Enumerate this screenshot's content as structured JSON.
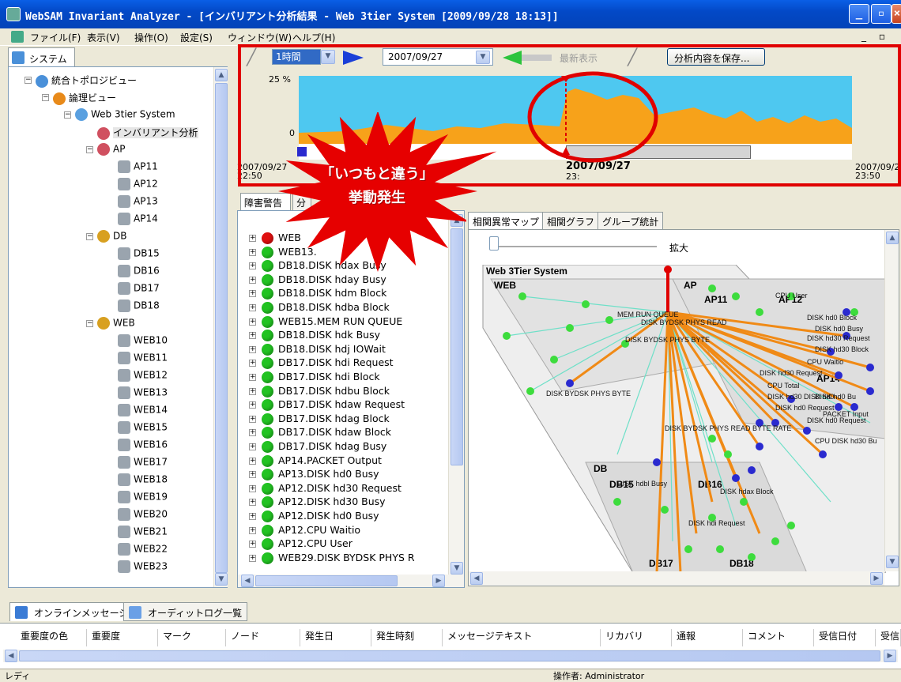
{
  "window": {
    "title": "WebSAM Invariant Analyzer - [インバリアント分析結果 - Web 3tier System [2009/09/28 18:13]]"
  },
  "menu": [
    "ファイル(F)",
    "表示(V)",
    "操作(O)",
    "設定(S)",
    "ウィンドウ(W)",
    "ヘルプ(H)"
  ],
  "left": {
    "tab_label": "システム",
    "tree": [
      {
        "label": "統合トポロジビュー",
        "level": 0
      },
      {
        "label": "論理ビュー",
        "level": 1
      },
      {
        "label": "Web 3tier System",
        "level": 2
      },
      {
        "label": "インバリアント分析",
        "level": 3
      },
      {
        "label": "AP",
        "level": 3
      },
      {
        "label": "AP11",
        "level": 4
      },
      {
        "label": "AP12",
        "level": 4
      },
      {
        "label": "AP13",
        "level": 4
      },
      {
        "label": "AP14",
        "level": 4
      },
      {
        "label": "DB",
        "level": 3
      },
      {
        "label": "DB15",
        "level": 4
      },
      {
        "label": "DB16",
        "level": 4
      },
      {
        "label": "DB17",
        "level": 4
      },
      {
        "label": "DB18",
        "level": 4
      },
      {
        "label": "WEB",
        "level": 3
      },
      {
        "label": "WEB10",
        "level": 4
      },
      {
        "label": "WEB11",
        "level": 4
      },
      {
        "label": "WEB12",
        "level": 4
      },
      {
        "label": "WEB13",
        "level": 4
      },
      {
        "label": "WEB14",
        "level": 4
      },
      {
        "label": "WEB15",
        "level": 4
      },
      {
        "label": "WEB16",
        "level": 4
      },
      {
        "label": "WEB17",
        "level": 4
      },
      {
        "label": "WEB18",
        "level": 4
      },
      {
        "label": "WEB19",
        "level": 4
      },
      {
        "label": "WEB20",
        "level": 4
      },
      {
        "label": "WEB21",
        "level": 4
      },
      {
        "label": "WEB22",
        "level": 4
      },
      {
        "label": "WEB23",
        "level": 4
      }
    ]
  },
  "timeline": {
    "interval": "1時間",
    "date": "2007/09/27",
    "latest_label": "最新表示",
    "save_label": "分析内容を保存...",
    "y_max": "25 %",
    "y_min": "0",
    "start_label": "2007/09/27",
    "start_time": "22:50",
    "center_label": "2007/09/27",
    "center_time": "23:",
    "end_label": "2007/09/2",
    "end_time": "23:50",
    "callout_line1": "「いつもと違う」",
    "callout_line2": "挙動発生"
  },
  "middle": {
    "tab1": "障害警告",
    "tab2": "分",
    "rows": [
      {
        "label": "WEB",
        "status": "warn"
      },
      {
        "label": "WEB13.",
        "status": "ok"
      },
      {
        "label": "DB18.DISK hdax Busy",
        "status": "ok"
      },
      {
        "label": "DB18.DISK hday Busy",
        "status": "ok"
      },
      {
        "label": "DB18.DISK hdm Block",
        "status": "ok"
      },
      {
        "label": "DB18.DISK hdba Block",
        "status": "ok"
      },
      {
        "label": "WEB15.MEM RUN QUEUE",
        "status": "ok"
      },
      {
        "label": "DB18.DISK hdk Busy",
        "status": "ok"
      },
      {
        "label": "DB18.DISK hdj IOWait",
        "status": "ok"
      },
      {
        "label": "DB17.DISK hdi Request",
        "status": "ok"
      },
      {
        "label": "DB17.DISK hdi Block",
        "status": "ok"
      },
      {
        "label": "DB17.DISK hdbu Block",
        "status": "ok"
      },
      {
        "label": "DB17.DISK hdaw Request",
        "status": "ok"
      },
      {
        "label": "DB17.DISK hdag Block",
        "status": "ok"
      },
      {
        "label": "DB17.DISK hdaw Block",
        "status": "ok"
      },
      {
        "label": "DB17.DISK hdag Busy",
        "status": "ok"
      },
      {
        "label": "AP14.PACKET Output",
        "status": "ok"
      },
      {
        "label": "AP13.DISK hd0 Busy",
        "status": "ok"
      },
      {
        "label": "AP12.DISK hd30 Request",
        "status": "ok"
      },
      {
        "label": "AP12.DISK hd30 Busy",
        "status": "ok"
      },
      {
        "label": "AP12.DISK hd0 Busy",
        "status": "ok"
      },
      {
        "label": "AP12.CPU Waitio",
        "status": "ok"
      },
      {
        "label": "AP12.CPU User",
        "status": "ok"
      },
      {
        "label": "WEB29.DISK BYDSK PHYS R",
        "status": "ok"
      }
    ]
  },
  "right": {
    "tabs": [
      "相関異常マップ",
      "相関グラフ",
      "グループ統計"
    ],
    "zoom_label": "拡大",
    "map_title": "Web 3Tier System",
    "groups": {
      "web": "WEB",
      "ap": "AP",
      "db": "DB",
      "ap11": "AP11",
      "ap12": "AP12",
      "ap14": "AP14",
      "db15": "DB15",
      "db16": "DB16",
      "db17": "DB17",
      "db18": "DB18"
    },
    "node_labels": [
      "CPU User",
      "MEM RUN QUEUE",
      "DISK BYDSK PHYS READ",
      "DISK hd0 Block",
      "DISK hd0 Busy",
      "DISK hd30 Request",
      "DISK hd30 Block",
      "DISK BYDSK PHYS BYTE",
      "CPU Waitio",
      "DISK hd30 Request",
      "CPU Total",
      "DISK hd30 DISK hd0",
      "DISK hd0 Bu",
      "DISK hd0 Request",
      "PACKET Input",
      "DISK hd0 Request",
      "DISK BYDSK PHYS READ BYTE RATE",
      "CPU DISK hd30 Bu",
      "DISK BYDSK PHYS BYTE",
      "DISK hdbl Busy",
      "DISK hdax Block",
      "DISK hdi Request"
    ]
  },
  "bottom": {
    "tabs": [
      "オンラインメッセージ",
      "オーディットログ一覧"
    ],
    "columns": [
      "重要度の色",
      "重要度",
      "マーク",
      "ノード",
      "発生日",
      "発生時刻",
      "メッセージテキスト",
      "リカバリ",
      "通報",
      "コメント",
      "受信日付",
      "受信"
    ]
  },
  "status": {
    "left": "レディ",
    "operator": "操作者: Administrator"
  },
  "colors": {
    "accent_red": "#e00000",
    "chart_cyan": "#4ec8f0",
    "chart_orange": "#f7a21a",
    "node_green": "#3ddc3d",
    "node_blue": "#2a2acf",
    "edge_orange": "#f08a16"
  }
}
